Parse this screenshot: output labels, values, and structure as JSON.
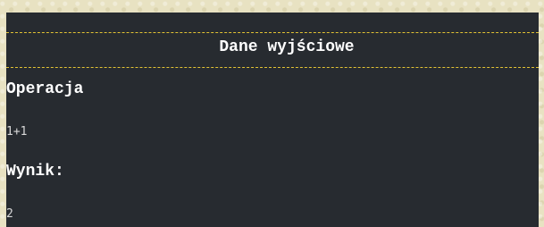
{
  "output_panel": {
    "title": "Dane wyjściowe",
    "operation_label": "Operacja",
    "operation_value": "1+1",
    "result_label": "Wynik:",
    "result_value": "2"
  },
  "colors": {
    "panel_background": "#272b30",
    "divider_dashes": "#e2c233",
    "page_background": "#e8e2c2"
  }
}
